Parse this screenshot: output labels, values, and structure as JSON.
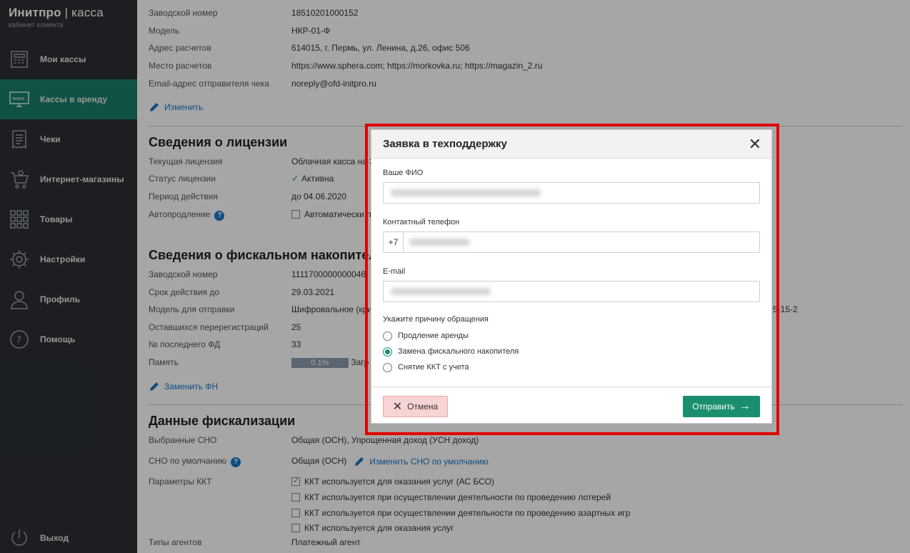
{
  "brand": {
    "title_bold": "Инитпро",
    "title_sep": " | ",
    "title_light": "касса",
    "subtitle": "кабинет клиента"
  },
  "sidebar": {
    "items": [
      {
        "label": "Мои кассы",
        "icon": "cash-register-icon"
      },
      {
        "label": "Кассы в аренду",
        "icon": "www-monitor-icon",
        "active": true
      },
      {
        "label": "Чеки",
        "icon": "receipt-icon"
      },
      {
        "label": "Интернет-магазины",
        "icon": "shopping-cart-icon"
      },
      {
        "label": "Товары",
        "icon": "grid-icon"
      },
      {
        "label": "Настройки",
        "icon": "gear-icon"
      },
      {
        "label": "Профиль",
        "icon": "user-icon"
      },
      {
        "label": "Помощь",
        "icon": "help-icon"
      }
    ],
    "logout": "Выход"
  },
  "top_info": [
    {
      "k": "Заводской номер",
      "v": "18510201000152"
    },
    {
      "k": "Модель",
      "v": "НКР-01-Ф"
    },
    {
      "k": "Адрес расчетов",
      "v": "614015, г. Пермь, ул. Ленина, д.26, офис 506"
    },
    {
      "k": "Место расчетов",
      "v": "https://www.sphera.com; https://morkovka.ru; https://magazin_2.ru"
    },
    {
      "k": "Email-адрес отправителя чека",
      "v": "noreply@ofd-initpro.ru"
    }
  ],
  "edit_link": "Изменить",
  "license": {
    "title": "Сведения о лицензии",
    "current_k": "Текущая лицензия",
    "current_v": "Облачная касса на 3",
    "status_k": "Статус лицензии",
    "status_v": "Активна",
    "period_k": "Период действия",
    "period_v": "до 04.06.2020",
    "auto_k": "Автопродление",
    "auto_v": "Автоматически п"
  },
  "fn": {
    "title": "Сведения о фискальном накопителе",
    "rows": [
      {
        "k": "Заводской номер",
        "v": "1111700000000046"
      },
      {
        "k": "Срок действия до",
        "v": "29.03.2021"
      },
      {
        "k": "Модель для отправки",
        "v": "Шифровальное (кри"
      },
      {
        "k": "Оставшихся перерегистраций",
        "v": "25"
      },
      {
        "k": "№ последнего ФД",
        "v": "33"
      }
    ],
    "memory_k": "Память",
    "memory_v": "0.1%",
    "memory_after": "Загр",
    "model_tail": "5-15-2",
    "replace_link": "Заменить ФН"
  },
  "fiscal": {
    "title": "Данные фискализации",
    "sno_k": "Выбранные СНО",
    "sno_v": "Общая (ОСН), Упрощенная доход (УСН доход)",
    "default_k": "СНО по умолчанию",
    "default_v": "Общая (ОСН)",
    "default_link": "Изменить СНО по умолчанию",
    "params_k": "Параметры ККТ",
    "params": [
      {
        "label": "ККТ используется для оказания услуг (АС БСО)",
        "checked": true
      },
      {
        "label": "ККТ используется при осуществлении деятельности по проведению лотерей",
        "checked": false
      },
      {
        "label": "ККТ используется при осуществлении деятельности по проведению азартных игр",
        "checked": false
      },
      {
        "label": "ККТ используется для оказания услуг",
        "checked": false
      }
    ],
    "agents_k": "Типы агентов",
    "agents_v": "Платежный агент"
  },
  "modal": {
    "title": "Заявка в техподдержку",
    "fio_label": "Ваше ФИО",
    "phone_label": "Контактный телефон",
    "phone_prefix": "+7",
    "email_label": "E-mail",
    "reason_label": "Укажите причину обращения",
    "reasons": [
      {
        "label": "Продление аренды",
        "selected": false
      },
      {
        "label": "Замена фискального накопителя",
        "selected": true
      },
      {
        "label": "Снятие ККТ с учета",
        "selected": false
      }
    ],
    "cancel": "Отмена",
    "send": "Отправить"
  },
  "colors": {
    "sidebar": "#2b2f33",
    "accent": "#1a7f6a",
    "link": "#1877c5",
    "highlight": "#e10000",
    "cancel_bg": "#f7d3d3"
  }
}
